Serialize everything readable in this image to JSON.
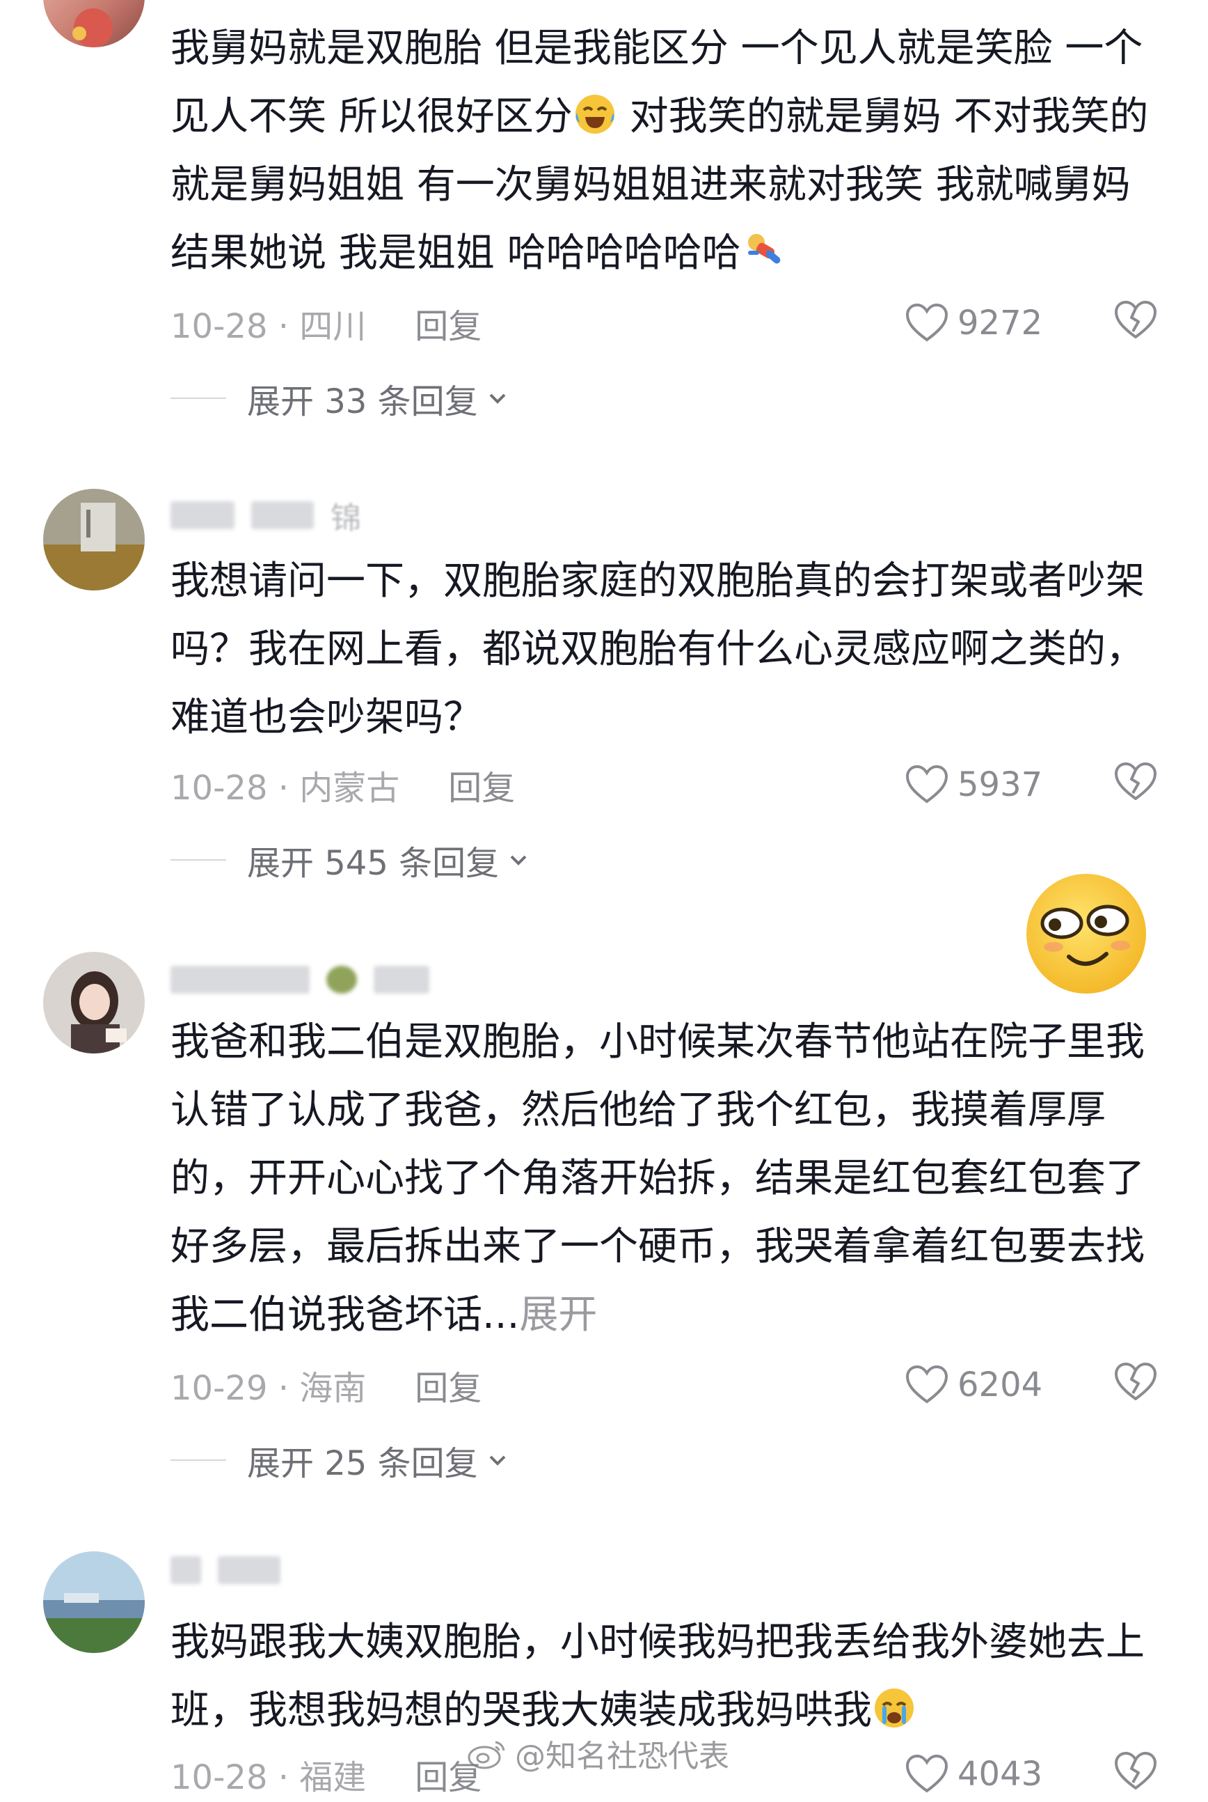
{
  "comments": [
    {
      "user": "",
      "text_a": "我舅妈就是双胞胎 但是我能区分 一个见人就是笑脸 一个见人不笑 所以很好区分",
      "text_b": " 对我笑的就是舅妈 不对我笑的就是舅妈姐姐 有一次舅妈姐姐进来就对我笑 我就喊舅妈 结果她说 我是姐姐 哈哈哈哈哈哈",
      "emoji_a": "laugh-cry-emoji",
      "emoji_b": "falling-person-emoji",
      "date_region": "10-28 · 四川",
      "reply_label": "回复",
      "likes": "9272",
      "expand_label": "展开 33 条回复"
    },
    {
      "user": "锦",
      "text": "我想请问一下，双胞胎家庭的双胞胎真的会打架或者吵架吗？我在网上看，都说双胞胎有什么心灵感应啊之类的，难道也会吵架吗？",
      "date_region": "10-28 · 内蒙古",
      "reply_label": "回复",
      "likes": "5937",
      "expand_label": "展开 545 条回复"
    },
    {
      "user": "",
      "text": "我爸和我二伯是双胞胎，小时候某次春节他站在院子里我认错了认成了我爸，然后他给了我个红包，我摸着厚厚的，开开心心找了个角落开始拆，结果是红包套红包套了好多层，最后拆出来了一个硬币，我哭着拿着红包要去找我二伯说我爸坏话...",
      "more_label": "展开",
      "date_region": "10-29 · 海南",
      "reply_label": "回复",
      "likes": "6204",
      "expand_label": "展开 25 条回复"
    },
    {
      "user": "",
      "text": "我妈跟我大姨双胞胎，小时候我妈把我丢给我外婆她去上班，我想我妈想的哭我大姨装成我妈哄我",
      "emoji": "crying-emoji",
      "date_region": "10-28 · 福建",
      "reply_label": "回复",
      "likes": "4043"
    }
  ],
  "floating_emoji": "smug-face-emoji",
  "watermark": "@知名社恐代表",
  "colors": {
    "text": "#161823",
    "meta": "#a8a9ad",
    "expand": "#6f7076",
    "background": "#ffffff"
  }
}
